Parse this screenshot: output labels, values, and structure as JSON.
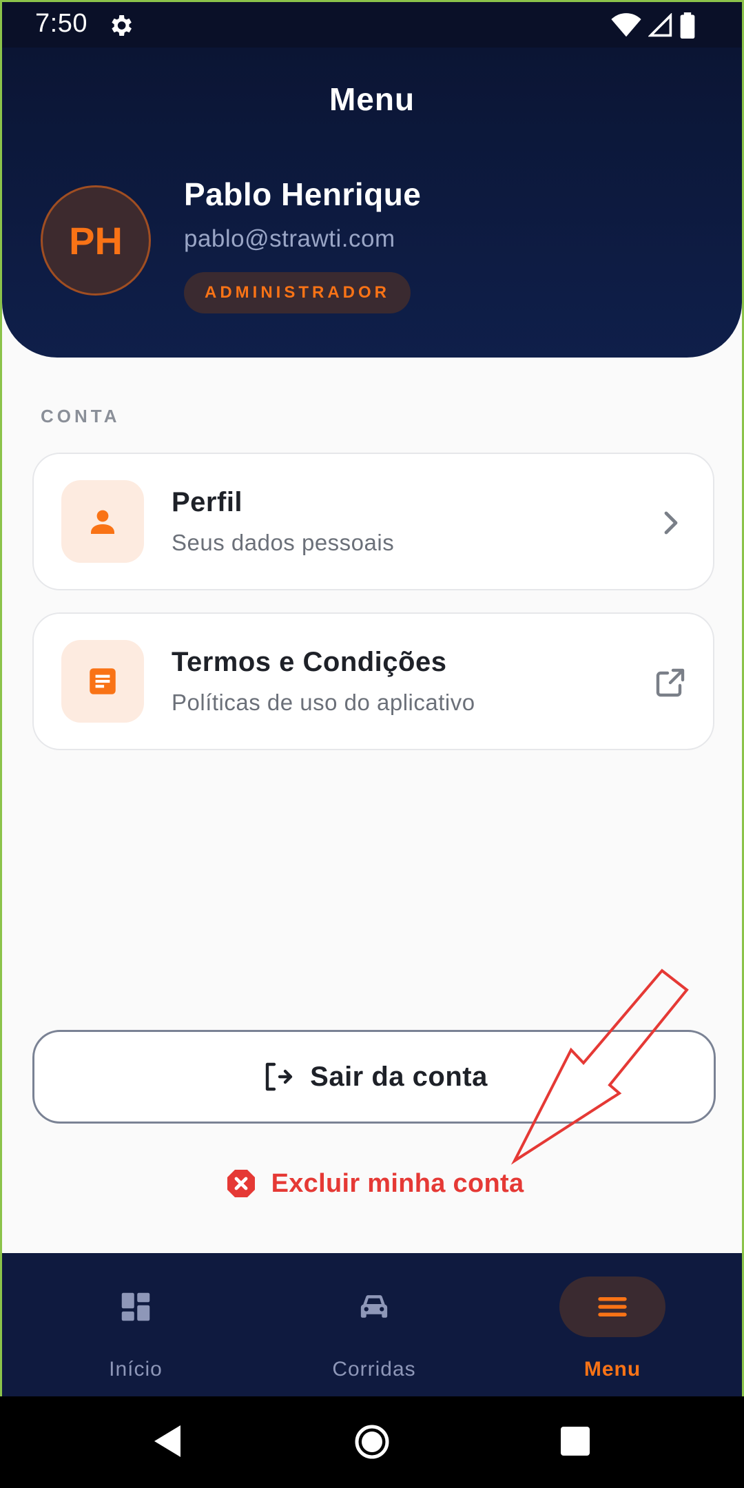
{
  "status_bar": {
    "time": "7:50"
  },
  "header": {
    "title": "Menu",
    "avatar_initials": "PH",
    "user_name": "Pablo Henrique",
    "user_email": "pablo@strawti.com",
    "role": "ADMINISTRADOR"
  },
  "section": {
    "label": "CONTA"
  },
  "items": [
    {
      "title": "Perfil",
      "subtitle": "Seus dados pessoais",
      "icon": "person-icon",
      "trail": "chevron-right-icon"
    },
    {
      "title": "Termos e Condições",
      "subtitle": "Políticas de uso do aplicativo",
      "icon": "document-icon",
      "trail": "open-external-icon"
    }
  ],
  "actions": {
    "logout_label": "Sair da conta",
    "delete_label": "Excluir minha conta"
  },
  "bottom_nav": [
    {
      "label": "Início",
      "icon": "dashboard-icon",
      "active": false
    },
    {
      "label": "Corridas",
      "icon": "car-icon",
      "active": false
    },
    {
      "label": "Menu",
      "icon": "menu-icon",
      "active": true
    }
  ],
  "colors": {
    "accent": "#f97316",
    "header_bg": "#0f1f4a",
    "danger": "#e53935",
    "annotation": "#e53935"
  }
}
